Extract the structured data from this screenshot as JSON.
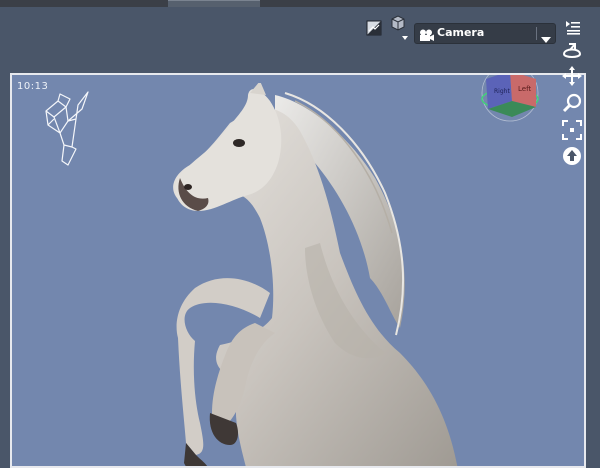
{
  "viewport": {
    "camera_label": "Camera",
    "timestamp": "10:13",
    "nav_cube_face_left": "Left",
    "nav_cube_face_right": "Right"
  },
  "toolbar": {
    "icons": [
      "render-toggle-icon",
      "draw-style-icon",
      "camera-icon",
      "dropdown-arrow-icon",
      "viewport-menu-icon"
    ]
  },
  "side_tools": [
    "orbit-icon",
    "pan-icon",
    "zoom-icon",
    "frame-icon",
    "reset-view-icon"
  ],
  "colors": {
    "background": "#7387ae",
    "toolbar": "#4a5669",
    "frame": "#e7e9ee"
  }
}
